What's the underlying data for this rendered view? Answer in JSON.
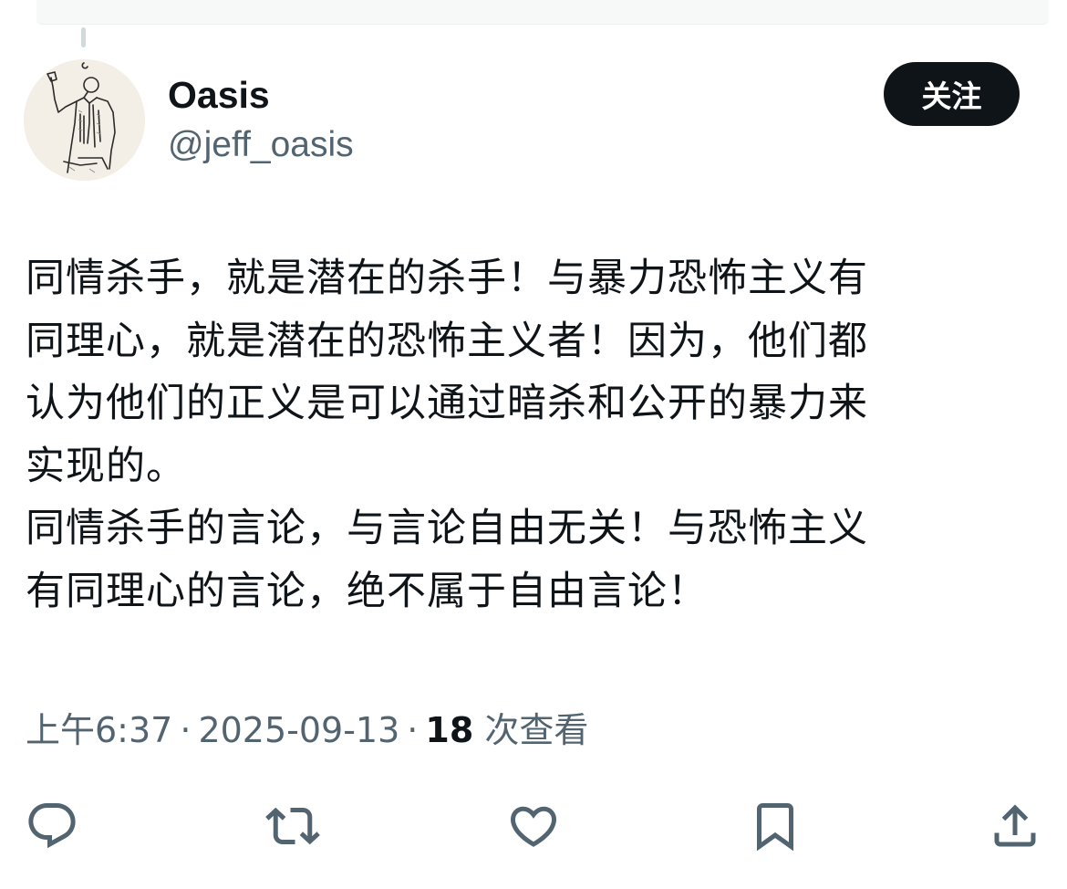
{
  "author": {
    "display_name": "Oasis",
    "handle": "@jeff_oasis",
    "avatar_icon": "avatar-sketch-figure"
  },
  "follow_button": {
    "label": "关注"
  },
  "tweet": {
    "paragraphs": [
      "同情杀手，就是潜在的杀手！与暴力恐怖主义有\n同理心，就是潜在的恐怖主义者！因为，他们都\n认为他们的正义是可以通过暗杀和公开的暴力来\n实现的。",
      "同情杀手的言论，与言论自由无关！与恐怖主义\n有同理心的言论，绝不属于自由言论！"
    ]
  },
  "meta": {
    "time": "上午6:37",
    "separator": "·",
    "date": "2025-09-13",
    "views_count": "18",
    "views_label": "次查看"
  },
  "actions": [
    {
      "name": "reply",
      "icon": "reply-icon"
    },
    {
      "name": "retweet",
      "icon": "retweet-icon"
    },
    {
      "name": "like",
      "icon": "heart-icon"
    },
    {
      "name": "bookmark",
      "icon": "bookmark-icon"
    },
    {
      "name": "share",
      "icon": "share-icon"
    }
  ],
  "colors": {
    "text_primary": "#0f1419",
    "text_secondary": "#536471",
    "button_bg": "#0f1419",
    "button_text": "#ffffff"
  }
}
